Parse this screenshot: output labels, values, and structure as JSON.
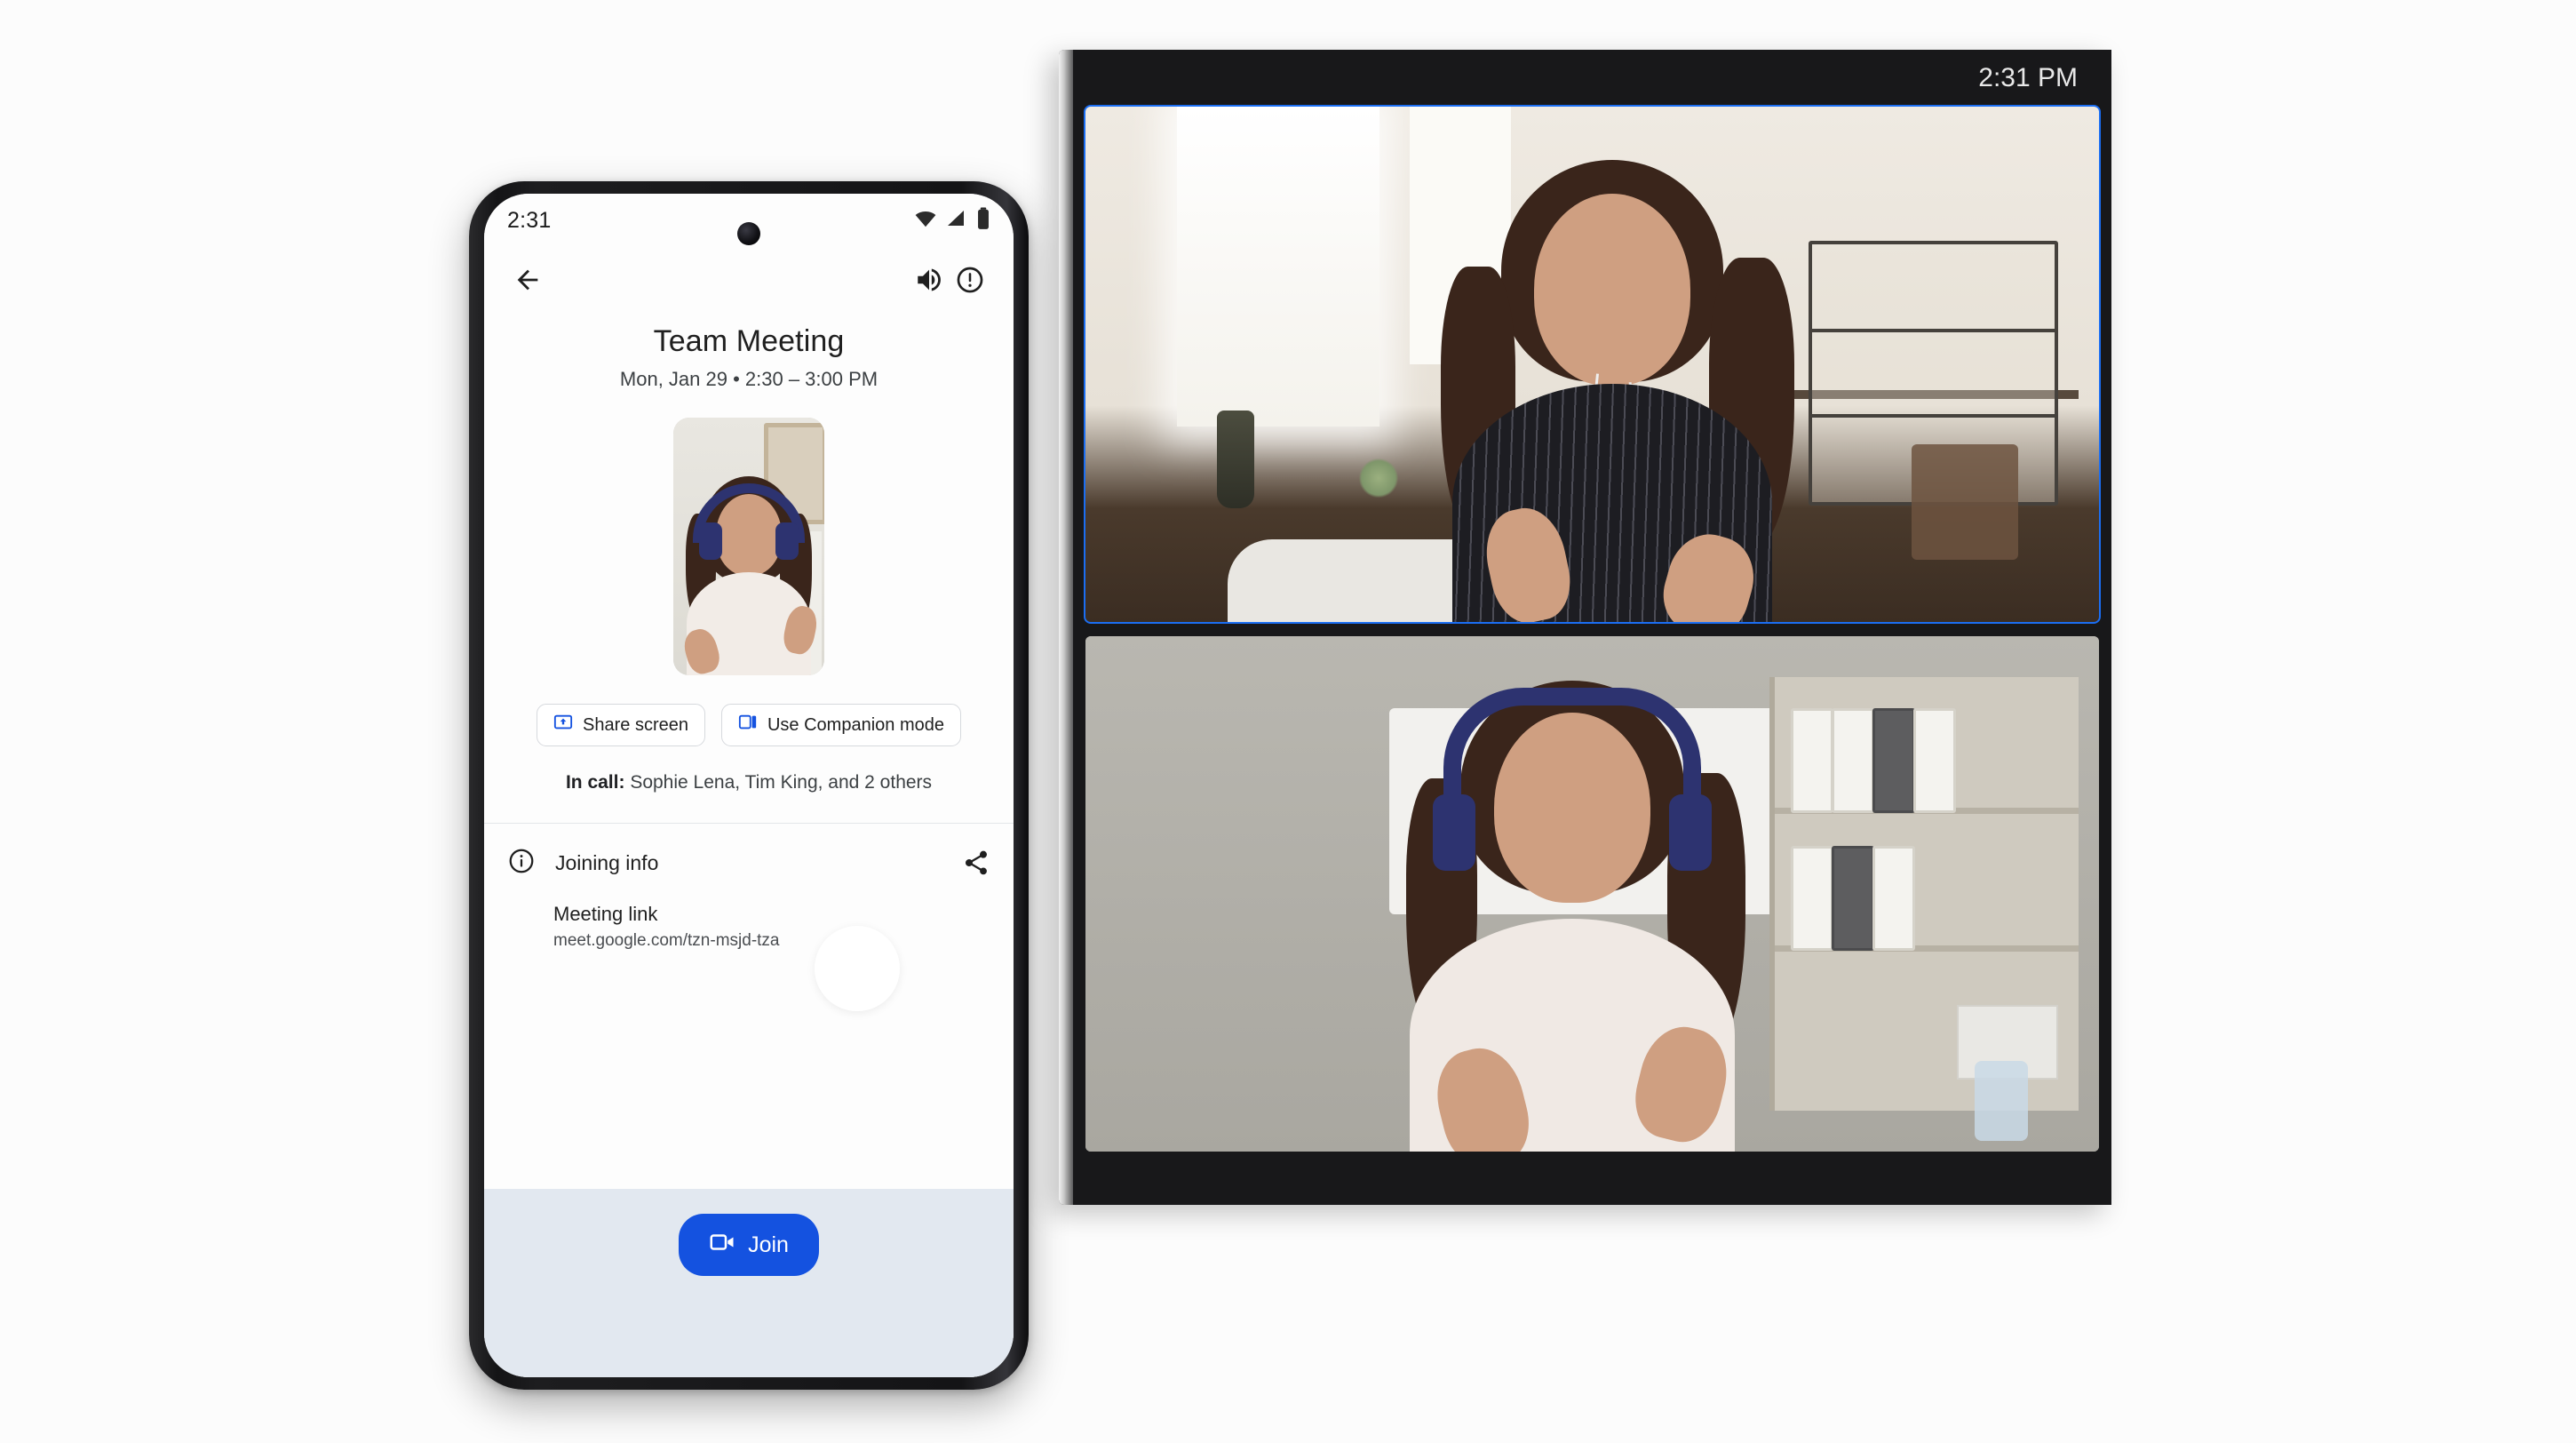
{
  "phone": {
    "status_bar": {
      "time": "2:31",
      "icons": [
        "wifi-icon",
        "cellular-signal-icon",
        "battery-icon"
      ]
    },
    "app_bar": {
      "back_icon": "arrow-back-icon",
      "volume_icon": "volume-up-icon",
      "info_icon": "exclamation-circle-icon"
    },
    "meeting": {
      "title": "Team Meeting",
      "subtitle": "Mon, Jan 29  •  2:30 – 3:00 PM"
    },
    "chips": [
      {
        "label": "Share screen",
        "icon": "present-to-all-icon"
      },
      {
        "label": "Use Companion mode",
        "icon": "companion-mode-icon"
      }
    ],
    "in_call": {
      "prefix": "In call:",
      "names": " Sophie Lena, Tim King, and 2 others"
    },
    "joining_info": {
      "icon": "info-circle-icon",
      "label": "Joining info",
      "share_icon": "share-icon",
      "link_label": "Meeting link",
      "link_value": "meet.google.com/tzn-msjd-tza"
    },
    "join_button": {
      "label": "Join",
      "icon": "video-camera-icon",
      "color": "#1452e0"
    },
    "self_view_label": "self-view-video"
  },
  "display": {
    "clock": "2:31 PM",
    "active_speaker_border_color": "#1b6ef3",
    "tiles": [
      {
        "name": "active-speaker-tile",
        "active": true
      },
      {
        "name": "participant-tile",
        "active": false
      }
    ]
  }
}
